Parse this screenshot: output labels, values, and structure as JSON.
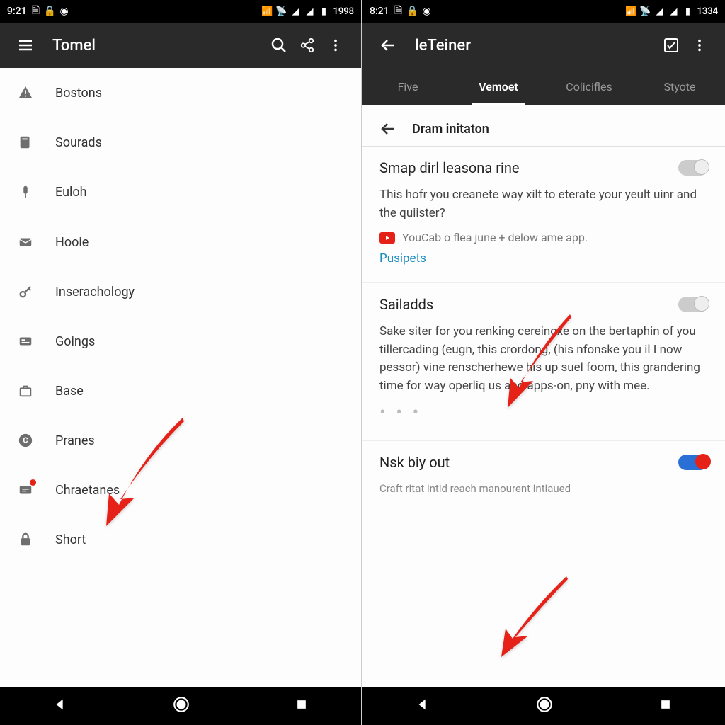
{
  "left": {
    "status": {
      "time": "9:21",
      "battery": "1998"
    },
    "appbar": {
      "title": "Tomel"
    },
    "menu": [
      {
        "icon": "warning",
        "label": "Bostons"
      },
      {
        "icon": "file",
        "label": "Sourads"
      },
      {
        "icon": "pin",
        "label": "Euloh"
      },
      {
        "icon": "mail",
        "label": "Hooie"
      },
      {
        "icon": "key",
        "label": "Inserachology"
      },
      {
        "icon": "card",
        "label": "Goings"
      },
      {
        "icon": "briefcase",
        "label": "Base"
      },
      {
        "icon": "circle-c",
        "label": "Pranes"
      },
      {
        "icon": "chat-badge",
        "label": "Chraetanes"
      },
      {
        "icon": "lock",
        "label": "Short"
      }
    ]
  },
  "right": {
    "status": {
      "time": "8:21",
      "battery": "1334"
    },
    "appbar": {
      "title": "leTeiner"
    },
    "tabs": [
      {
        "label": "Five",
        "active": false
      },
      {
        "label": "Vemoet",
        "active": true
      },
      {
        "label": "Colicifles",
        "active": false
      },
      {
        "label": "Styote",
        "active": false
      }
    ],
    "sectionTitle": "Dram initaton",
    "settings": {
      "s1": {
        "title": "Smap dirl leasona rine",
        "desc": "This hofr you creanete way xilt to eterate your yeult uinr and the quiister?",
        "subline": "YouCab o flea june + delow ame app.",
        "link": "Pusipets"
      },
      "s2": {
        "title": "Sailadds",
        "desc": "Sake siter for you renking cereinoxe on the bertaphin of you tillercading (eugn, this crordong, (his nfonske you il I now pessor) vine renscherhewe his up suel foom, this grandering time for way operliq us and apps-on, pny with mee."
      },
      "s3": {
        "title": "Nsk biy out",
        "desc": "Craft ritat intid reach manourent intiaued"
      }
    }
  }
}
